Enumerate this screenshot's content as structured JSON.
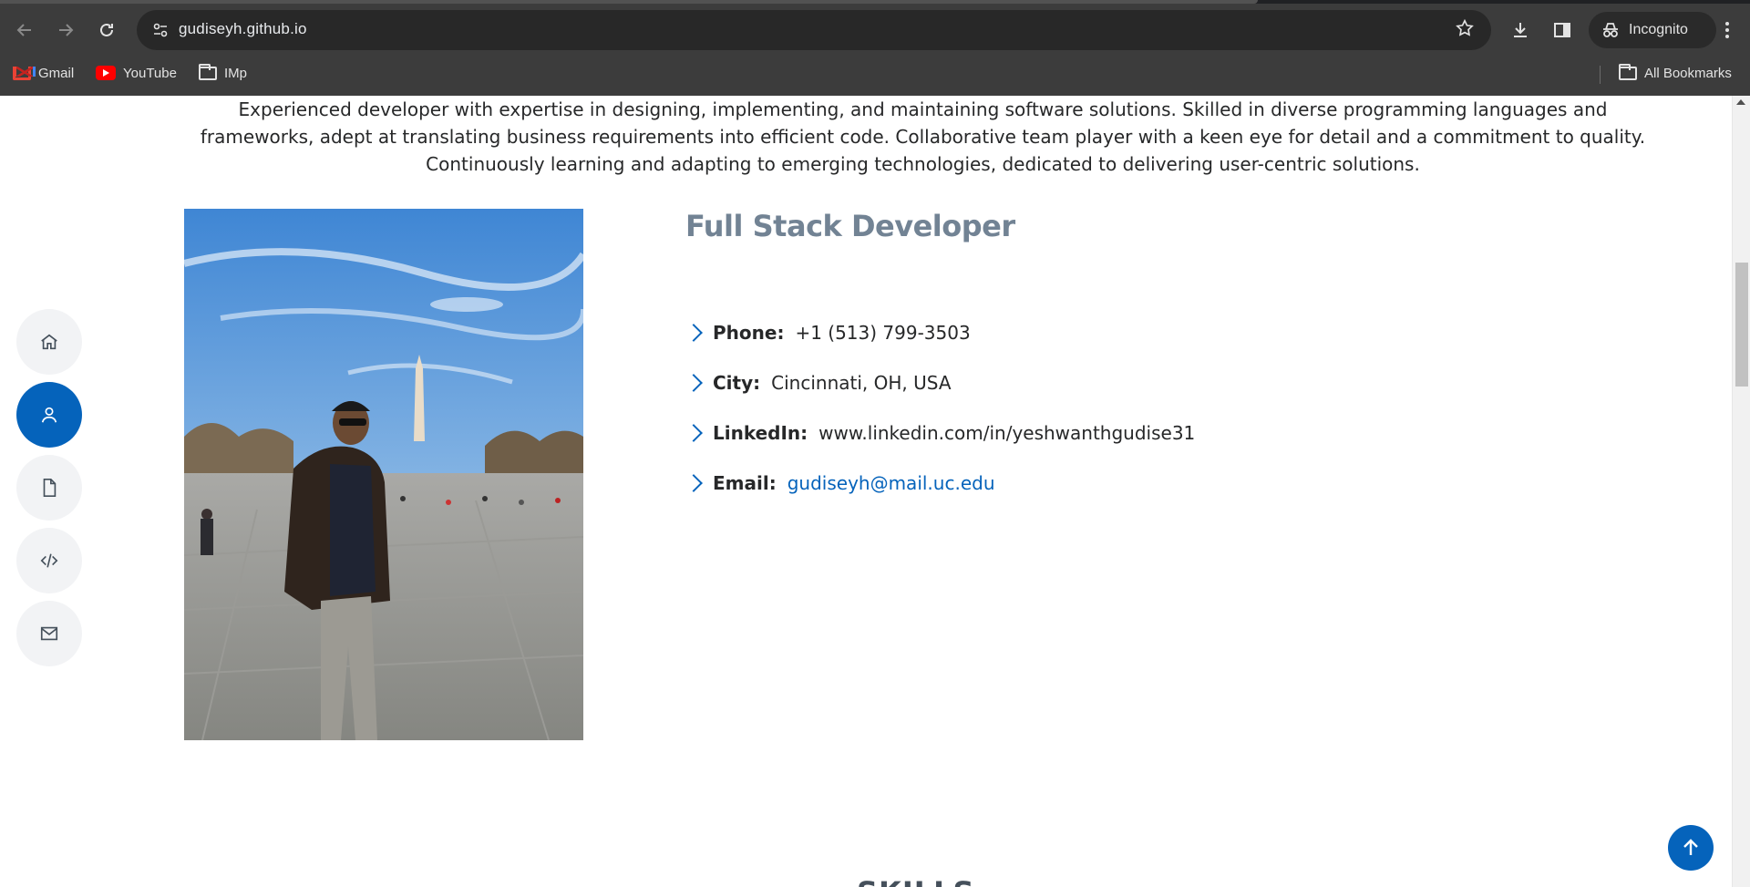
{
  "browser": {
    "url": "gudiseyh.github.io",
    "incognito_label": "Incognito",
    "bookmarks": [
      {
        "label": "Gmail"
      },
      {
        "label": "YouTube"
      },
      {
        "label": "IMp"
      }
    ],
    "all_bookmarks_label": "All Bookmarks"
  },
  "about": {
    "summary": "Experienced developer with expertise in designing, implementing, and maintaining software solutions. Skilled in diverse programming languages and frameworks, adept at translating business requirements into efficient code. Collaborative team player with a keen eye for detail and a commitment to quality. Continuously learning and adapting to emerging technologies, dedicated to delivering user-centric solutions.",
    "role": "Full Stack Developer",
    "details": [
      {
        "label": "Phone:",
        "value": "+1 (513) 799-3503"
      },
      {
        "label": "City:",
        "value": "Cincinnati, OH, USA"
      },
      {
        "label": "LinkedIn:",
        "value": "www.linkedin.com/in/yeshwanthgudise31"
      },
      {
        "label": "Email:",
        "value": "gudiseyh@mail.uc.edu"
      }
    ]
  },
  "sidenav": {
    "items": [
      {
        "icon": "home-icon",
        "active": false
      },
      {
        "icon": "person-icon",
        "active": true
      },
      {
        "icon": "file-icon",
        "active": false
      },
      {
        "icon": "code-icon",
        "active": false
      },
      {
        "icon": "envelope-icon",
        "active": false
      }
    ]
  },
  "next_section_heading": "SKILLS",
  "colors": {
    "accent": "#0563bb",
    "role_title": "#728394",
    "text": "#272829"
  }
}
